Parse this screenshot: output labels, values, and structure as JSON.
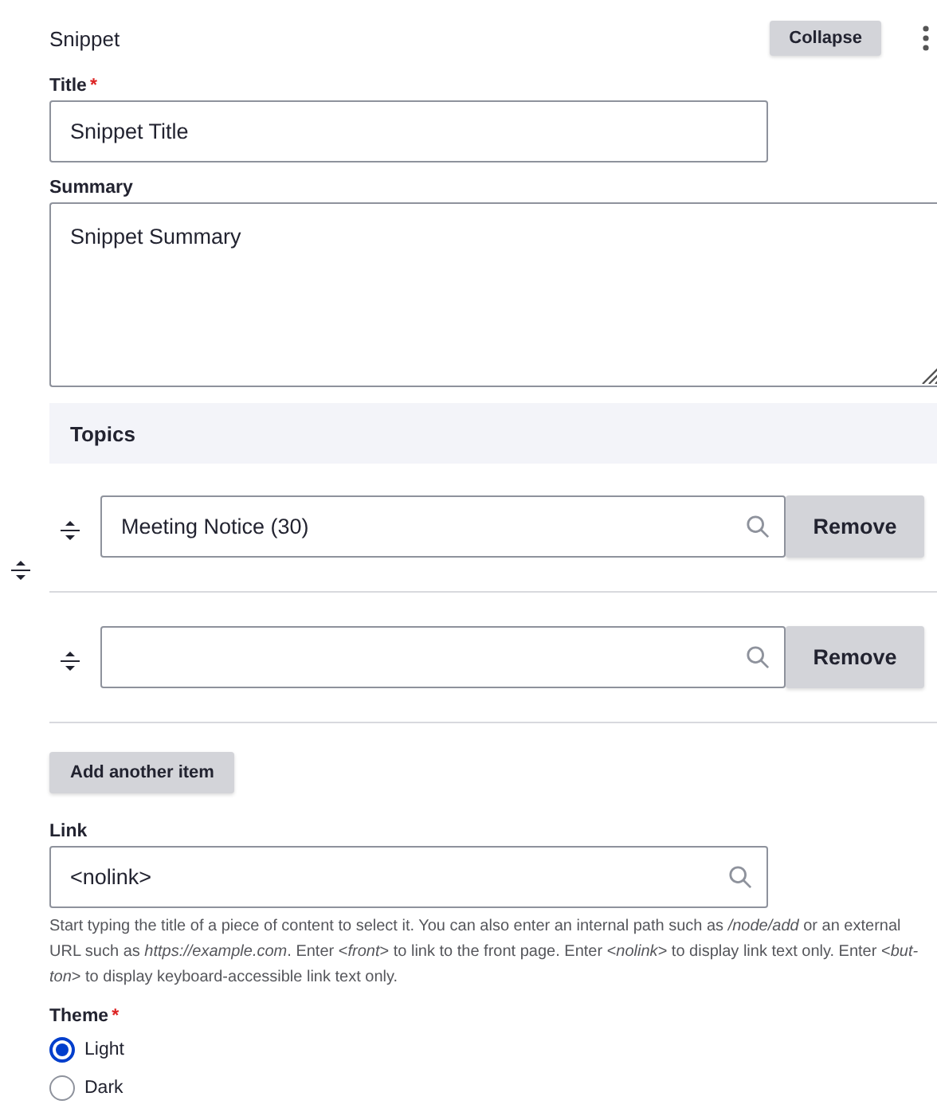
{
  "header": {
    "title": "Snippet",
    "collapse_button": "Collapse"
  },
  "title_field": {
    "label": "Title",
    "required_mark": "*",
    "value": "Snippet Title"
  },
  "summary_field": {
    "label": "Summary",
    "value": "Snippet Summary"
  },
  "topics": {
    "heading": "Topics",
    "items": [
      {
        "value": "Meeting Notice (30)",
        "remove_button": "Remove"
      },
      {
        "value": "",
        "remove_button": "Remove"
      }
    ],
    "add_button": "Add another item"
  },
  "link_field": {
    "label": "Link",
    "value": "<nolink>",
    "description": "Start typing the title of a piece of content to select it. You can also enter an internal path such as */node/add* or an external URL such as *https://example.com*. Enter <*front*> to link to the front page. Enter <*nolink*> to display link text only. Enter <*but-ton*> to display keyboard-accessible link text only."
  },
  "theme": {
    "label": "Theme",
    "required_mark": "*",
    "options": [
      {
        "label": "Light",
        "selected": true
      },
      {
        "label": "Dark",
        "selected": false
      }
    ]
  }
}
